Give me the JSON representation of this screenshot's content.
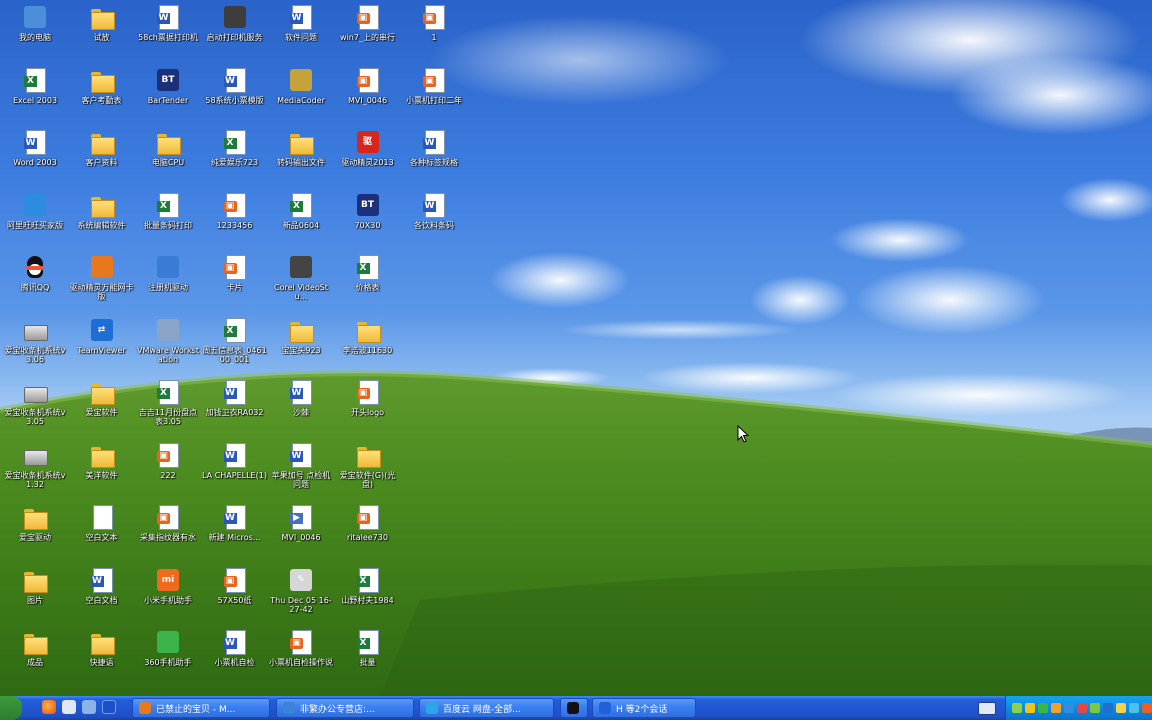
{
  "desktop": {
    "icons": [
      {
        "label": "我的电脑",
        "kind": "app",
        "color": "#4a8fd8",
        "glyph": ""
      },
      {
        "label": "Excel 2003",
        "kind": "excel"
      },
      {
        "label": "Word 2003",
        "kind": "word"
      },
      {
        "label": "阿里旺旺买家版",
        "kind": "app",
        "color": "#2b8ce0",
        "glyph": ""
      },
      {
        "label": "腾讯QQ",
        "kind": "qq"
      },
      {
        "label": "爱宝收条机系统v3.06",
        "kind": "drive"
      },
      {
        "label": "爱宝收条机系统v3.05",
        "kind": "drive"
      },
      {
        "label": "爱宝收条机系统v1.32",
        "kind": "drive"
      },
      {
        "label": "爱宝驱动",
        "kind": "folder"
      },
      {
        "label": "图片",
        "kind": "folder"
      },
      {
        "label": "成品",
        "kind": "folder"
      },
      {
        "label": "试放",
        "kind": "folder"
      },
      {
        "label": "客户考勤表",
        "kind": "folder"
      },
      {
        "label": "客户资料",
        "kind": "folder"
      },
      {
        "label": "系统编辑软件",
        "kind": "folder"
      },
      {
        "label": "驱动精灵万能网卡版",
        "kind": "app",
        "color": "#e8781d",
        "glyph": ""
      },
      {
        "label": "TeamViewer",
        "kind": "app",
        "color": "#1d6fd4",
        "glyph": "⇄"
      },
      {
        "label": "爱宝软件",
        "kind": "folder"
      },
      {
        "label": "美洋软件",
        "kind": "folder"
      },
      {
        "label": "空白文本",
        "kind": "doc"
      },
      {
        "label": "空白文档",
        "kind": "word"
      },
      {
        "label": "快捷语",
        "kind": "folder"
      },
      {
        "label": "58ch票据打印机",
        "kind": "word"
      },
      {
        "label": "BarTender",
        "kind": "app",
        "color": "#1b2f7a",
        "glyph": "BT"
      },
      {
        "label": "电脑CPU",
        "kind": "folder"
      },
      {
        "label": "批量条码打印",
        "kind": "excel"
      },
      {
        "label": "注册机驱动",
        "kind": "app",
        "color": "#3a7bd5",
        "glyph": ""
      },
      {
        "label": "VMware Workstation",
        "kind": "app",
        "color": "#8aa4c8",
        "glyph": ""
      },
      {
        "label": "吉吉11月份盘点表3.05",
        "kind": "excel"
      },
      {
        "label": "222",
        "kind": "img"
      },
      {
        "label": "采集指纹器有水",
        "kind": "img"
      },
      {
        "label": "小米手机助手",
        "kind": "app",
        "color": "#f06a1d",
        "glyph": "mi"
      },
      {
        "label": "360手机助手",
        "kind": "app",
        "color": "#3cb44b",
        "glyph": ""
      },
      {
        "label": "启动打印机服务",
        "kind": "app",
        "color": "#3d3d3d",
        "glyph": ""
      },
      {
        "label": "58系统小票模版",
        "kind": "word"
      },
      {
        "label": "纯爱娱乐723",
        "kind": "excel"
      },
      {
        "label": "1233456",
        "kind": "img"
      },
      {
        "label": "卡片",
        "kind": "img"
      },
      {
        "label": "周五信息表_046100_001",
        "kind": "excel"
      },
      {
        "label": "加钱卫衣RA032",
        "kind": "word"
      },
      {
        "label": "LA CHAPELLE(1)",
        "kind": "word"
      },
      {
        "label": "新建 Micros...",
        "kind": "word"
      },
      {
        "label": "57X50纸",
        "kind": "img"
      },
      {
        "label": "小票机自检",
        "kind": "word"
      },
      {
        "label": "软件问题",
        "kind": "word"
      },
      {
        "label": "MediaCoder",
        "kind": "app",
        "color": "#c6a23a",
        "glyph": ""
      },
      {
        "label": "转码输出文件",
        "kind": "folder"
      },
      {
        "label": "新品0604",
        "kind": "excel"
      },
      {
        "label": "Corel VideoStu...",
        "kind": "app",
        "color": "#444",
        "glyph": ""
      },
      {
        "label": "宝宝头923",
        "kind": "folder"
      },
      {
        "label": "沙棘",
        "kind": "word"
      },
      {
        "label": "苹果加号 点检机问题",
        "kind": "word"
      },
      {
        "label": "MVI_0046",
        "kind": "vid"
      },
      {
        "label": "Thu Dec 05 16-27-42",
        "kind": "app",
        "color": "#d6d6d6",
        "glyph": "✎"
      },
      {
        "label": "小票机自检操作说",
        "kind": "img"
      },
      {
        "label": "win7_上的串行",
        "kind": "img"
      },
      {
        "label": "MVI_0046",
        "kind": "img"
      },
      {
        "label": "驱动精灵2013",
        "kind": "app",
        "color": "#d9261c",
        "glyph": "驱"
      },
      {
        "label": "70X30",
        "kind": "app",
        "color": "#1b2f7a",
        "glyph": "BT"
      },
      {
        "label": "价格表",
        "kind": "excel"
      },
      {
        "label": "李浩波11630",
        "kind": "folder"
      },
      {
        "label": "开头logo",
        "kind": "img"
      },
      {
        "label": "爱宝软件(G)(光盘)",
        "kind": "folder"
      },
      {
        "label": "ritalee730",
        "kind": "img"
      },
      {
        "label": "山野村夫1984",
        "kind": "excel"
      },
      {
        "label": "批量",
        "kind": "excel"
      },
      {
        "label": "1",
        "kind": "img"
      },
      {
        "label": "小票机打印二年",
        "kind": "img"
      },
      {
        "label": "各种标签规格",
        "kind": "word"
      },
      {
        "label": "各饮料条码",
        "kind": "word"
      }
    ]
  },
  "taskbar": {
    "tasks": [
      {
        "label": "已禁止的宝贝 - M...",
        "color": "#e87a1e"
      },
      {
        "label": "非繁办公专营店:...",
        "color": "#3b82d9"
      },
      {
        "label": "百度云 网盘-全部...",
        "color": "#2da6e8"
      },
      {
        "label": "",
        "color": "#111111"
      },
      {
        "label": "H 等2个会话",
        "color": "#2060d8"
      }
    ],
    "tray_colors": [
      "#8bd14b",
      "#f0c419",
      "#3ab54a",
      "#f0a030",
      "#2f8ee0",
      "#e04848",
      "#7ac943",
      "#1f6fd0",
      "#f2d34b",
      "#4bc0e8",
      "#e85f2a",
      "#5ab552"
    ]
  }
}
